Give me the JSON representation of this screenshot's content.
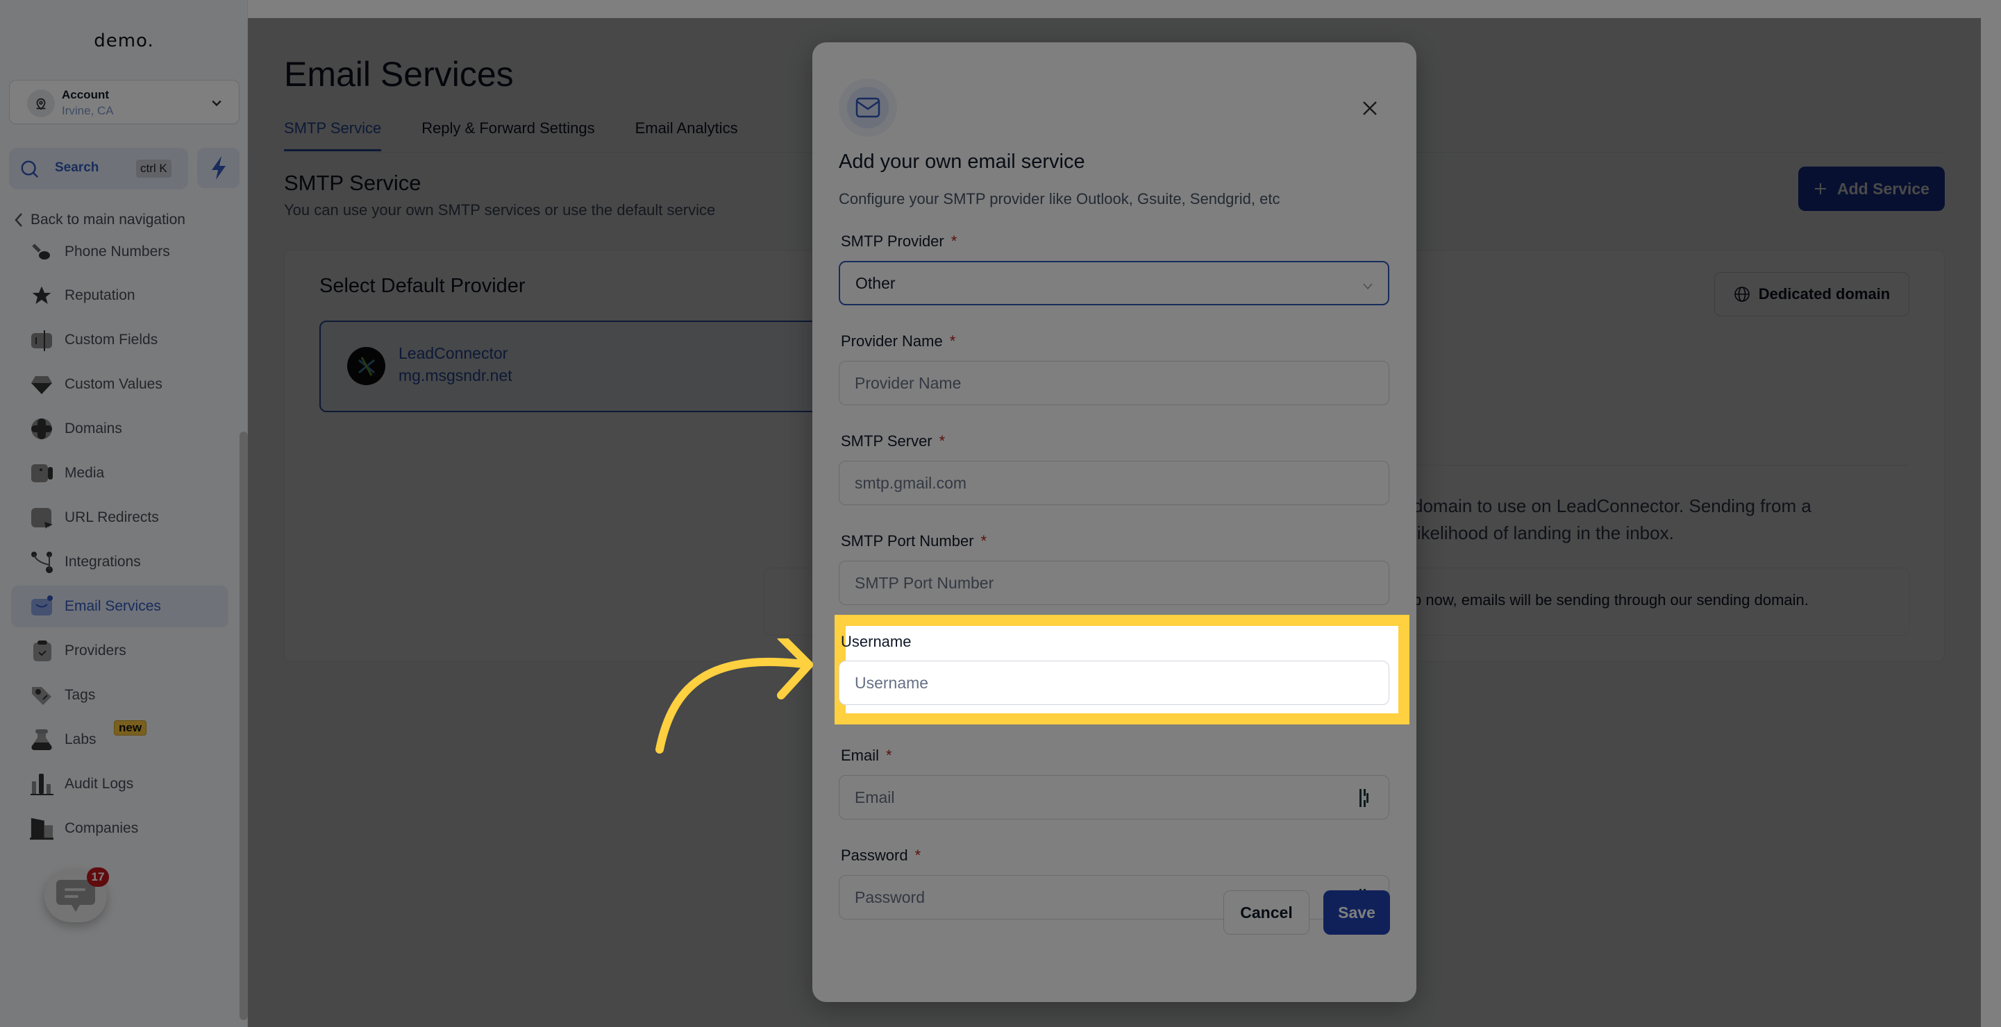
{
  "sidebar": {
    "logo": "demo.",
    "account": {
      "name": "Account",
      "location": "Irvine, CA"
    },
    "search": {
      "label": "Search",
      "shortcut": "ctrl K"
    },
    "back_label": "Back to main navigation",
    "items": [
      {
        "label": "Phone Numbers",
        "icon": "phone-icon"
      },
      {
        "label": "Reputation",
        "icon": "star-icon"
      },
      {
        "label": "Custom Fields",
        "icon": "custom-fields-icon"
      },
      {
        "label": "Custom Values",
        "icon": "gem-icon"
      },
      {
        "label": "Domains",
        "icon": "globe-icon"
      },
      {
        "label": "Media",
        "icon": "video-icon"
      },
      {
        "label": "URL Redirects",
        "icon": "redirect-icon"
      },
      {
        "label": "Integrations",
        "icon": "integrations-icon"
      },
      {
        "label": "Email Services",
        "icon": "mail-icon",
        "active": true
      },
      {
        "label": "Providers",
        "icon": "clipboard-check-icon"
      },
      {
        "label": "Tags",
        "icon": "tag-icon"
      },
      {
        "label": "Labs",
        "icon": "flask-icon",
        "badge": "new"
      },
      {
        "label": "Audit Logs",
        "icon": "bar-chart-icon"
      },
      {
        "label": "Companies",
        "icon": "building-icon"
      }
    ],
    "chat_badge": "17"
  },
  "main": {
    "title": "Email Services",
    "tabs": [
      {
        "label": "SMTP Service",
        "active": true
      },
      {
        "label": "Reply & Forward Settings"
      },
      {
        "label": "Email Analytics"
      }
    ],
    "section_title": "SMTP Service",
    "section_desc": "You can use your own SMTP services or use the default service",
    "add_service_label": "Add Service",
    "card": {
      "title": "Select Default Provider",
      "provider": {
        "name": "LeadConnector",
        "domain": "mg.msgsndr.net"
      },
      "dedicated_domain_label": "Dedicated domain",
      "dedicated_text": "domain to use on LeadConnector. Sending from a likelihood of landing in the inbox.",
      "info_text": "p now, emails will be sending through our sending domain."
    }
  },
  "modal": {
    "title": "Add your own email service",
    "subtitle": "Configure your SMTP provider like Outlook, Gsuite, Sendgrid, etc",
    "fields": {
      "smtp_provider": {
        "label": "SMTP Provider",
        "required": "*",
        "value": "Other"
      },
      "provider_name": {
        "label": "Provider Name",
        "required": "*",
        "placeholder": "Provider Name"
      },
      "smtp_server": {
        "label": "SMTP Server",
        "required": "*",
        "placeholder": "smtp.gmail.com"
      },
      "smtp_port": {
        "label": "SMTP Port Number",
        "required": "*",
        "placeholder": "SMTP Port Number"
      },
      "username": {
        "label": "Username",
        "placeholder": "Username"
      },
      "email": {
        "label": "Email",
        "required": "*",
        "placeholder": "Email"
      },
      "password": {
        "label": "Password",
        "required": "*",
        "placeholder": "Password"
      }
    },
    "cancel_label": "Cancel",
    "save_label": "Save"
  },
  "colors": {
    "accent": "#2E56B8",
    "highlight": "#FFD03F",
    "required": "#B42318"
  }
}
